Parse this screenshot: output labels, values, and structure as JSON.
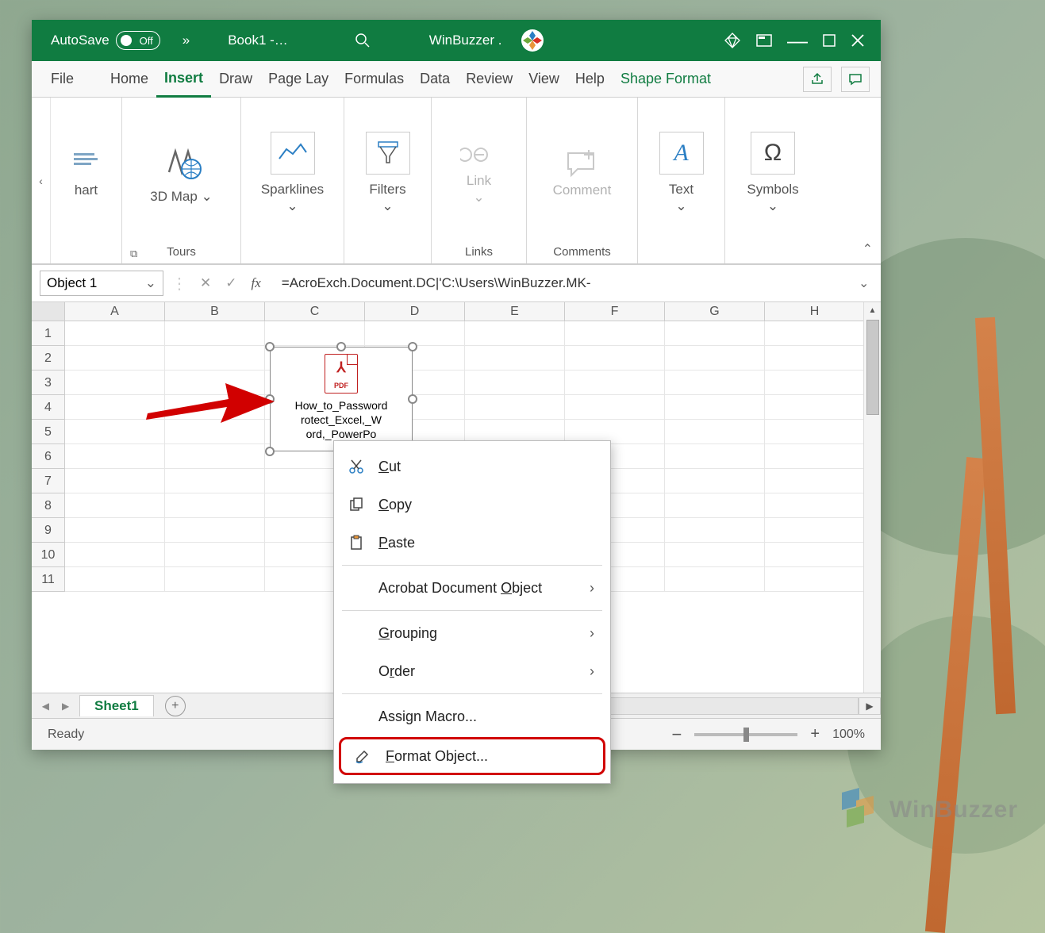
{
  "titlebar": {
    "autosave_label": "AutoSave",
    "autosave_state": "Off",
    "overflow": "»",
    "doc_name": "Book1  -…",
    "account": "WinBuzzer ."
  },
  "tabs": {
    "file": "File",
    "home": "Home",
    "insert": "Insert",
    "draw": "Draw",
    "page_lay": "Page Lay",
    "formulas": "Formulas",
    "data": "Data",
    "review": "Review",
    "view": "View",
    "help": "Help",
    "shape_format": "Shape Format"
  },
  "ribbon": {
    "chart_hint": "hart",
    "map3d": "3D Map",
    "tours_label": "Tours",
    "sparklines": "Sparklines",
    "filters": "Filters",
    "link": "Link",
    "links_label": "Links",
    "comment": "Comment",
    "comments_label": "Comments",
    "text": "Text",
    "symbols": "Symbols"
  },
  "formula": {
    "name": "Object 1",
    "fx_label": "fx",
    "text": "=AcroExch.Document.DC|'C:\\Users\\WinBuzzer.MK-"
  },
  "columns": [
    "A",
    "B",
    "C",
    "D",
    "E",
    "F",
    "G",
    "H"
  ],
  "rows": [
    "1",
    "2",
    "3",
    "4",
    "5",
    "6",
    "7",
    "8",
    "9",
    "10",
    "11"
  ],
  "embedded": {
    "pdf_badge": "PDF",
    "line1": "How_to_Password",
    "line2": "rotect_Excel,_W",
    "line3": "ord,_PowerPo"
  },
  "ctxmenu": {
    "cut": "Cut",
    "copy": "Copy",
    "paste": "Paste",
    "acrobat": "Acrobat Document Object",
    "grouping": "Grouping",
    "order": "Order",
    "assign_macro": "Assign Macro...",
    "format_object": "Format Object..."
  },
  "sheet": {
    "tab1": "Sheet1"
  },
  "status": {
    "ready": "Ready",
    "zoom": "100%"
  },
  "watermark": "WinBuzzer"
}
